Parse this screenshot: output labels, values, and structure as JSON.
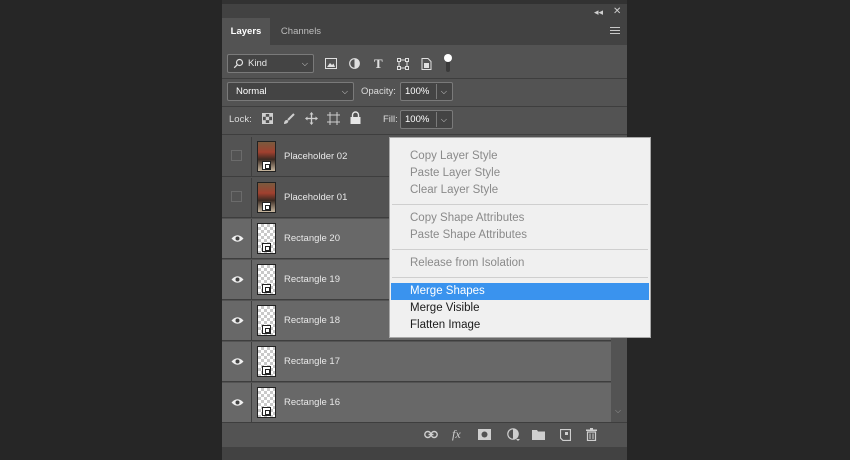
{
  "panel": {
    "collapse_icon": "double-chevron-icon",
    "close_icon": "close-icon"
  },
  "tabs": [
    {
      "label": "Layers",
      "active": true
    },
    {
      "label": "Channels",
      "active": false
    }
  ],
  "filter": {
    "kind_label": "Kind",
    "icons": [
      "image-filter-icon",
      "adjustment-filter-icon",
      "type-filter-icon",
      "shape-filter-icon",
      "smart-object-filter-icon",
      "filter-toggle-icon"
    ]
  },
  "blend": {
    "mode": "Normal",
    "opacity_label": "Opacity:",
    "opacity_value": "100%"
  },
  "lock": {
    "label": "Lock:",
    "icons": [
      "lock-transparency-icon",
      "lock-pixels-icon",
      "lock-position-icon",
      "lock-artboard-icon",
      "lock-all-icon"
    ],
    "fill_label": "Fill:",
    "fill_value": "100%"
  },
  "layers": [
    {
      "name": "Placeholder 02",
      "visible": false,
      "type": "photo",
      "selected": false
    },
    {
      "name": "Placeholder 01",
      "visible": false,
      "type": "photo",
      "selected": false
    },
    {
      "name": "Rectangle 20",
      "visible": true,
      "type": "shape",
      "selected": true
    },
    {
      "name": "Rectangle 19",
      "visible": true,
      "type": "shape",
      "selected": true
    },
    {
      "name": "Rectangle 18",
      "visible": true,
      "type": "shape",
      "selected": true
    },
    {
      "name": "Rectangle 17",
      "visible": true,
      "type": "shape",
      "selected": true
    },
    {
      "name": "Rectangle 16",
      "visible": true,
      "type": "shape",
      "selected": true
    }
  ],
  "bottom_icons": [
    "link-layers-icon",
    "fx-icon",
    "add-mask-icon",
    "new-adjustment-icon",
    "new-group-icon",
    "new-layer-icon",
    "delete-layer-icon"
  ],
  "bottom_labels": {
    "fx": "fx"
  },
  "context_menu": {
    "items": [
      {
        "label": "Copy Layer Style",
        "enabled": false,
        "highlighted": false
      },
      {
        "label": "Paste Layer Style",
        "enabled": false,
        "highlighted": false
      },
      {
        "label": "Clear Layer Style",
        "enabled": false,
        "highlighted": false
      },
      {
        "label": "Copy Shape Attributes",
        "enabled": false,
        "highlighted": false
      },
      {
        "label": "Paste Shape Attributes",
        "enabled": false,
        "highlighted": false
      },
      {
        "label": "Release from Isolation",
        "enabled": false,
        "highlighted": false
      },
      {
        "label": "Merge Shapes",
        "enabled": true,
        "highlighted": true
      },
      {
        "label": "Merge Visible",
        "enabled": true,
        "highlighted": false
      },
      {
        "label": "Flatten Image",
        "enabled": true,
        "highlighted": false
      }
    ]
  },
  "colors": {
    "panel_bg": "#535353",
    "selected_row": "#686868",
    "menu_bg": "#f0f0f0",
    "menu_highlight": "#3a93ee"
  }
}
